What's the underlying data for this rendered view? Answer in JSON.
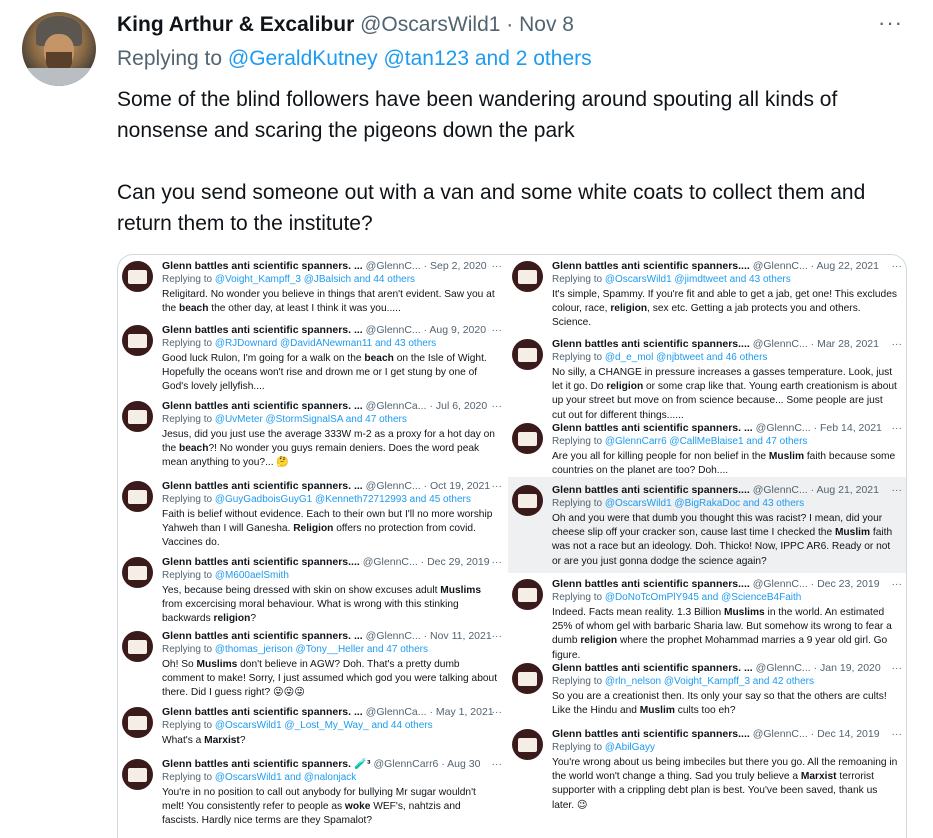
{
  "tweet": {
    "author_name": "King Arthur & Excalibur",
    "handle": "@OscarsWild1",
    "separator": " · ",
    "date": "Nov 8",
    "more_icon": "more-horizontal-icon",
    "replying_prefix": "Replying to ",
    "replying_users": "@GeraldKutney @tan123",
    "replying_suffix": " and 2 others",
    "paragraph1": "Some of the blind followers have been wandering around spouting all kinds of nonsense and scaring the pigeons down the park",
    "paragraph2": "Can you send someone out with a van and some white coats to collect them and return them to the institute?"
  },
  "media": {
    "left": [
      {
        "name": "Glenn battles anti scientific spanners. ...",
        "handle": "@GlennC...",
        "date": "· Sep 2, 2020",
        "replying": "Replying to ",
        "users": "@Voight_Kampff_3 @JBalsich and 44 others",
        "text": "Religitard. No wonder you believe in things that aren't evident. Saw you at the beach the other day, at least I think it was you....."
      },
      {
        "name": "Glenn battles anti scientific spanners. ...",
        "handle": "@GlennC...",
        "date": "· Aug 9, 2020",
        "replying": "Replying to ",
        "users": "@RJDownard @DavidANewman11 and 43 others",
        "text": "Good luck Rulon, I'm going for a walk on the beach on the Isle of Wight. Hopefully the oceans won't rise and drown me or I get stung by one of God's lovely jellyfish...."
      },
      {
        "name": "Glenn battles anti scientific spanners. ...",
        "handle": "@GlennCa...",
        "date": "· Jul 6, 2020",
        "replying": "Replying to ",
        "users": "@UvMeter @StormSignalSA and 47 others",
        "text": "Jesus, did you just use the average 333W m-2 as a proxy for a hot day on the beach?! No wonder you guys remain deniers. Does the word peak mean anything to you?... 🤔"
      },
      {
        "name": "Glenn battles anti scientific spanners. ...",
        "handle": "@GlennC...",
        "date": "· Oct 19, 2021",
        "replying": "Replying to ",
        "users": "@GuyGadboisGuyG1 @Kenneth72712993 and 45 others",
        "text": "Faith is belief without evidence. Each to their own but I'll no more worship Yahweh than I will Ganesha. Religion offers no protection from covid. Vaccines do."
      },
      {
        "name": "Glenn battles anti scientific spanners....",
        "handle": "@GlennC...",
        "date": "· Dec 29, 2019",
        "replying": "Replying to ",
        "users": "@M600aelSmith",
        "text": "Yes, because being dressed with skin on show excuses adult Muslims from excercising moral behaviour. What is wrong with this stinking backwards religion?"
      },
      {
        "name": "Glenn battles anti scientific spanners. ...",
        "handle": "@GlennC...",
        "date": "· Nov 11, 2021",
        "replying": "Replying to ",
        "users": "@thomas_jerison @Tony__Heller and 47 others",
        "text": "Oh! So Muslims don't believe in AGW? Doh. That's a pretty dumb comment to make! Sorry, I just assumed which god you were talking about there. Did I guess right? 😜😜😜"
      },
      {
        "name": "Glenn battles anti scientific spanners. ...",
        "handle": "@GlennCa...",
        "date": "· May 1, 2021",
        "replying": "Replying to ",
        "users": "@OscarsWild1 @_Lost_My_Way_ and 44 others",
        "text": "What's a Marxist?"
      },
      {
        "name": "Glenn battles anti scientific spanners. 🧪³",
        "handle": "@GlennCarr6",
        "date": "· Aug 30",
        "replying": "Replying to ",
        "users": "@OscarsWild1 and @nalonjack",
        "text": "You're in no position to call out anybody for bullying Mr sugar wouldn't melt! You consistently refer to people as woke WEF's, nahtzis and fascists. Hardly nice terms are they Spamalot?"
      }
    ],
    "right": [
      {
        "name": "Glenn battles anti scientific spanners....",
        "handle": "@GlennC...",
        "date": "· Aug 22, 2021",
        "replying": "Replying to ",
        "users": "@OscarsWild1 @jimdtweet and 43 others",
        "text": "It's simple, Spammy. If you're fit and able to get a jab, get one! This excludes colour, race, religion, sex etc. Getting a jab protects you and others. Science."
      },
      {
        "name": "Glenn battles anti scientific spanners....",
        "handle": "@GlennC...",
        "date": "· Mar 28, 2021",
        "replying": "Replying to ",
        "users": "@d_e_mol @njbtweet and 46 others",
        "text": "No silly, a CHANGE in pressure increases a gasses temperature. Look, just let it go. Do religion or some crap like that. Young earth creationism is about up your street but move on from science because... Some people are just cut out for different things......"
      },
      {
        "name": "Glenn battles anti scientific spanners. ...",
        "handle": "@GlennC...",
        "date": "· Feb 14, 2021",
        "replying": "Replying to ",
        "users": "@GlennCarr6 @CallMeBlaise1 and 47 others",
        "text": "Are you all for killing people for non belief in the Muslim faith because some countries on the planet are too? Doh...."
      },
      {
        "name": "Glenn battles anti scientific spanners....",
        "handle": "@GlennC...",
        "date": "· Aug 21, 2021",
        "replying": "Replying to ",
        "users": "@OscarsWild1 @BigRakaDoc and 43 others",
        "text": "Oh and you were that dumb you thought this was racist? I mean, did your cheese slip off your cracker son, cause last time I checked the Muslim faith was not a race but an ideology. Doh. Thicko! Now, IPPC AR6. Ready or not or are you just gonna dodge the science again?"
      },
      {
        "name": "Glenn battles anti scientific spanners....",
        "handle": "@GlennC...",
        "date": "· Dec 23, 2019",
        "replying": "Replying to ",
        "users": "@DoNoTcOmPlY945 and @ScienceB4Faith",
        "text": "Indeed. Facts mean reality. 1.3 Billion Muslims in the world. An estimated 25% of whom gel with barbaric Sharia law. But somehow its wrong to fear a dumb religion where the prophet Mohammad marries a 9 year old girl. Go figure."
      },
      {
        "name": "Glenn battles anti scientific spanners. ...",
        "handle": "@GlennC...",
        "date": "· Jan 19, 2020",
        "replying": "Replying to ",
        "users": "@rln_nelson @Voight_Kampff_3 and 42 others",
        "text": "So you are a creationist then. Its only your say so that the others are cults! Like the Hindu and Muslim cults too eh?"
      },
      {
        "name": "Glenn battles anti scientific spanners....",
        "handle": "@GlennC...",
        "date": "· Dec 14, 2019",
        "replying": "Replying to ",
        "users": "@AbilGayy",
        "text": "You're wrong about us being imbeciles but there you go. All the remoaning in the world won't change a thing. Sad you truly believe a Marxist terrorist supporter with a crippling debt plan is best. You've been saved, thank us later. 😉"
      }
    ],
    "more_glyph": "···"
  }
}
